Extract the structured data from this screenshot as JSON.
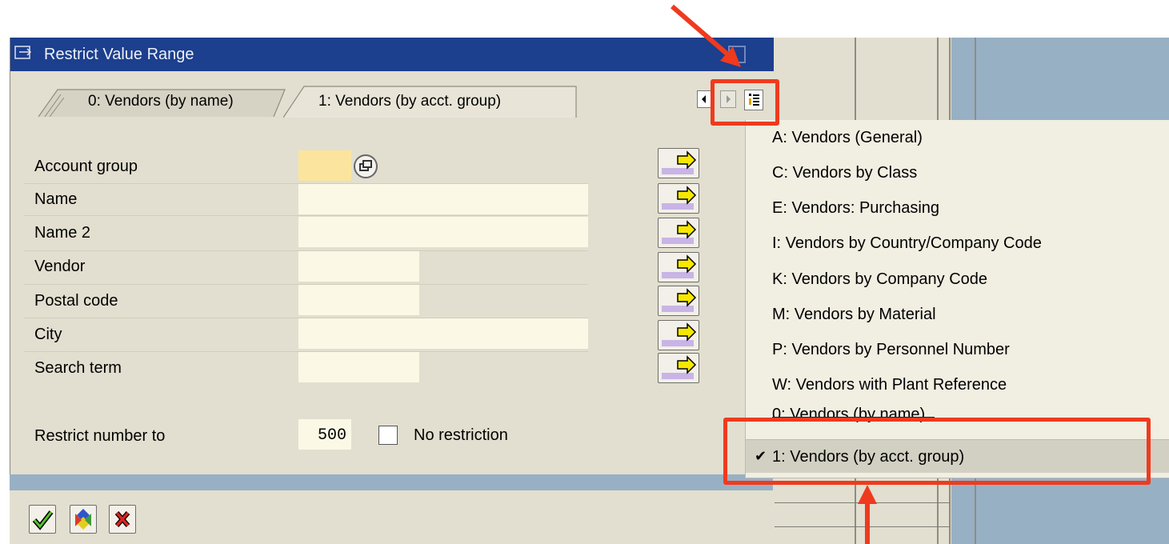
{
  "dialog": {
    "title": "Restrict Value Range",
    "tabs": [
      {
        "label": "0: Vendors (by name)"
      },
      {
        "label": "1: Vendors (by acct. group)"
      }
    ],
    "fields": [
      {
        "label": "Account group",
        "value": ""
      },
      {
        "label": "Name",
        "value": ""
      },
      {
        "label": "Name 2",
        "value": ""
      },
      {
        "label": "Vendor",
        "value": ""
      },
      {
        "label": "Postal code",
        "value": ""
      },
      {
        "label": "City",
        "value": ""
      },
      {
        "label": "Search term",
        "value": ""
      }
    ],
    "restrict": {
      "label": "Restrict number to",
      "value": "500",
      "no_restriction_label": "No restriction",
      "no_restriction_checked": false
    },
    "footer_buttons": [
      "check-icon",
      "find-icon",
      "cancel-icon"
    ]
  },
  "menu": {
    "items": [
      {
        "label": "A: Vendors (General)"
      },
      {
        "label": "C: Vendors by Class"
      },
      {
        "label": "E: Vendors: Purchasing"
      },
      {
        "label": "I: Vendors by Country/Company Code"
      },
      {
        "label": "K: Vendors by Company Code"
      },
      {
        "label": "M: Vendors by Material"
      },
      {
        "label": "P: Vendors by Personnel Number"
      },
      {
        "label": "W: Vendors with Plant Reference"
      },
      {
        "label": "0: Vendors (by name)"
      },
      {
        "label": "1: Vendors (by acct. group)",
        "checked": true
      }
    ],
    "check_glyph": "✔"
  },
  "colors": {
    "title_bar": "#1c3f8e",
    "dialog_bg": "#e2dfd0",
    "required_field": "#fbe59e",
    "highlight": "#ef3a1e"
  }
}
